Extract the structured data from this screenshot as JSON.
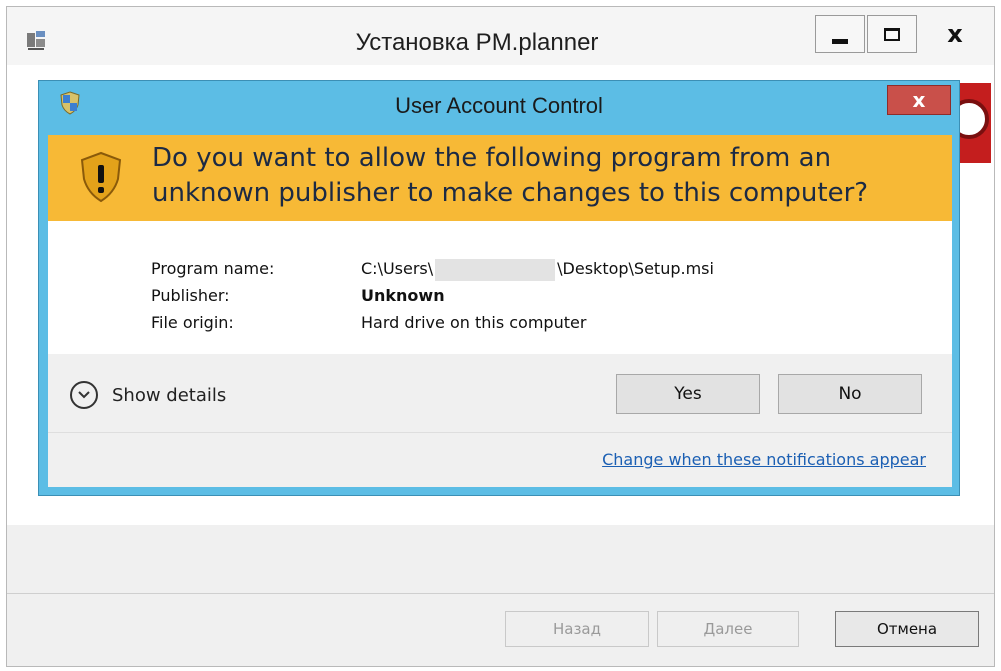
{
  "installer": {
    "title": "Установка PM.planner",
    "window_controls": {
      "minimize_icon": "minimize-icon",
      "maximize_icon": "maximize-icon",
      "close_symbol": "x"
    },
    "buttons": {
      "back": "Назад",
      "next": "Далее",
      "cancel": "Отмена"
    }
  },
  "uac": {
    "title": "User Account Control",
    "close_symbol": "x",
    "question": "Do you want to allow the following program from an unknown publisher to make changes to this computer?",
    "program_name_label": "Program name:",
    "program_name_prefix": "C:\\Users\\",
    "program_name_suffix": "\\Desktop\\Setup.msi",
    "publisher_label": "Publisher:",
    "publisher_value": "Unknown",
    "file_origin_label": "File origin:",
    "file_origin_value": "Hard drive on this computer",
    "show_details": "Show details",
    "yes": "Yes",
    "no": "No",
    "change_link": "Change when these notifications appear"
  },
  "colors": {
    "uac_frame": "#5cbde5",
    "uac_warning": "#f7b936",
    "uac_close": "#c9504a",
    "link": "#1b5fb3"
  }
}
